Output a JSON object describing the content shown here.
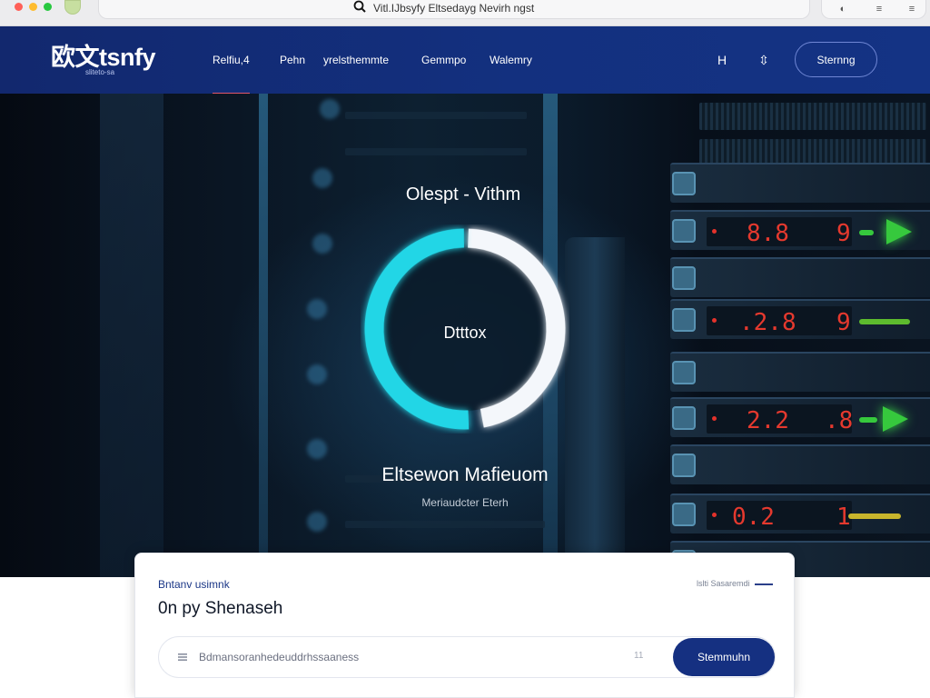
{
  "browser": {
    "url": "Vitl.IJbsyfy  Eltsedayg Nevirh ngst",
    "icons": [
      "circle-half-icon",
      "list-icon",
      "menu-icon"
    ]
  },
  "header": {
    "logo": "欧文tsnfy",
    "logo_sub": "sliteto-sa",
    "nav": [
      "Relfiu,4",
      "Pehn",
      "yrelsthemmte",
      "Gemmpo",
      "Walemry"
    ],
    "active_nav_index": 0,
    "icon_h": "H",
    "icon_send": "⇳",
    "button": "Sternng"
  },
  "hero": {
    "heading": "Olespt - Vithm",
    "ring_center": "Dtttox",
    "ring_fraction": 0.52,
    "title": "Eltsewon Mafieuom",
    "subtitle": "Meriaudcter Eterh",
    "readouts": [
      {
        "left": "8.8",
        "right": "9"
      },
      {
        "left": ".2.8",
        "right": "9"
      },
      {
        "left": "2.2",
        "right": ".8"
      },
      {
        "left": "0.2",
        "right": "1"
      }
    ],
    "colors": {
      "ring_cyan": "#22d6e6",
      "ring_white": "#f4f7fb",
      "led_red": "#e5392e",
      "led_green": "#36c93d"
    }
  },
  "card": {
    "eyebrow": "Bntanv usimnk",
    "link": "lslti Sasaremdi",
    "title": "0n py Shenaseh",
    "search_placeholder": "Bdmansoranhedeuddrhssaaness",
    "search_hint": "11",
    "search_button": "Stemmuhn"
  }
}
